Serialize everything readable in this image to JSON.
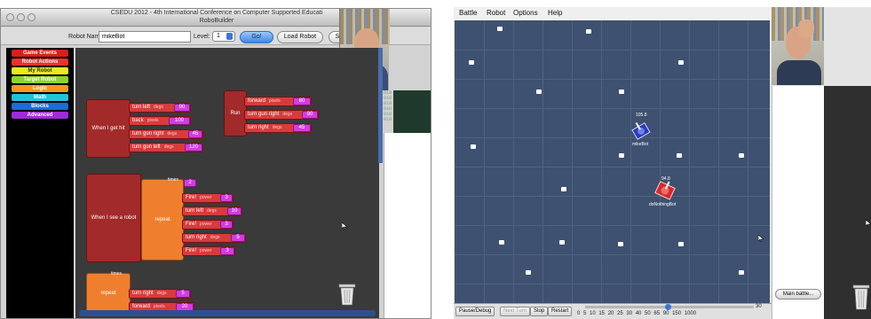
{
  "left_window": {
    "title": "CSEDU 2012 - 4th International Conference on Computer Supported Educati",
    "subtitle": "RoboBuilder",
    "toolbar": {
      "robot_name_label": "Robot Name:",
      "robot_name_value": "mikeBot",
      "level_label": "Level:",
      "level_value": "1",
      "go_label": "Go!",
      "load_label": "Load Robot",
      "extra_label": "S"
    }
  },
  "categories": [
    {
      "label": "Game Events",
      "color": "#d42020"
    },
    {
      "label": "Robot Actions",
      "color": "#e8332c"
    },
    {
      "label": "My Robot",
      "color": "#eaea1c"
    },
    {
      "label": "Target Robot",
      "color": "#8bd62b"
    },
    {
      "label": "Logic",
      "color": "#f19a1c"
    },
    {
      "label": "Math",
      "color": "#1ec5d9"
    },
    {
      "label": "Blocks",
      "color": "#1e6bd9"
    },
    {
      "label": "Advanced",
      "color": "#a02ad9"
    }
  ],
  "hit_script": {
    "event": "When I get hit",
    "blocks": [
      {
        "label": "turn left",
        "unit": "degs",
        "value": "90"
      },
      {
        "label": "back",
        "unit": "pixels",
        "value": "100"
      },
      {
        "label": "turn gun right",
        "unit": "degs",
        "value": "45"
      },
      {
        "label": "turn gun left",
        "unit": "degs",
        "value": "120"
      }
    ]
  },
  "run_script": {
    "event": "Run",
    "blocks": [
      {
        "label": "forward",
        "unit": "pixels",
        "value": "80"
      },
      {
        "label": "turn gun right",
        "unit": "degs",
        "value": "90"
      },
      {
        "label": "turn right",
        "unit": "degs",
        "value": "45"
      }
    ]
  },
  "see_script": {
    "event": "When I see a robot",
    "repeat_label": "repeat",
    "times_label": "times",
    "times_value": "2",
    "blocks": [
      {
        "label": "Fire!",
        "unit": "power",
        "value": "3"
      },
      {
        "label": "turn left",
        "unit": "degs",
        "value": "10"
      },
      {
        "label": "Fire!",
        "unit": "power",
        "value": "3"
      },
      {
        "label": "turn right",
        "unit": "degs",
        "value": "5"
      },
      {
        "label": "Fire!",
        "unit": "power",
        "value": "3"
      }
    ]
  },
  "loose_script": {
    "repeat_label": "repeat",
    "times_label": "times",
    "blocks": [
      {
        "label": "turn right",
        "unit": "degs",
        "value": "5"
      },
      {
        "label": "forward",
        "unit": "pixels",
        "value": "20"
      }
    ]
  },
  "right_window": {
    "menu": [
      "Battle",
      "Robot",
      "Options",
      "Help"
    ],
    "robots": [
      {
        "name": "mikeBot",
        "energy": "105.8"
      },
      {
        "name": "doNothingBot",
        "energy": "94.8"
      }
    ],
    "controls": {
      "pause_label": "Pause/Debug",
      "next_turn_label": "Next Turn",
      "stop_label": "Stop",
      "restart_label": "Restart",
      "tps_ticks": "0 5 10 15 20 25 30 40 50 65 90 150 1000",
      "tps_max": "30",
      "tps_level": 0.49
    },
    "main_battle_label": "Main battle..."
  },
  "colors": {
    "battlefield": "#3e5170",
    "canvas": "#3a3a3a",
    "block_red": "#d83b3b",
    "block_magenta": "#d63be0",
    "block_orange": "#ef7f2e"
  }
}
